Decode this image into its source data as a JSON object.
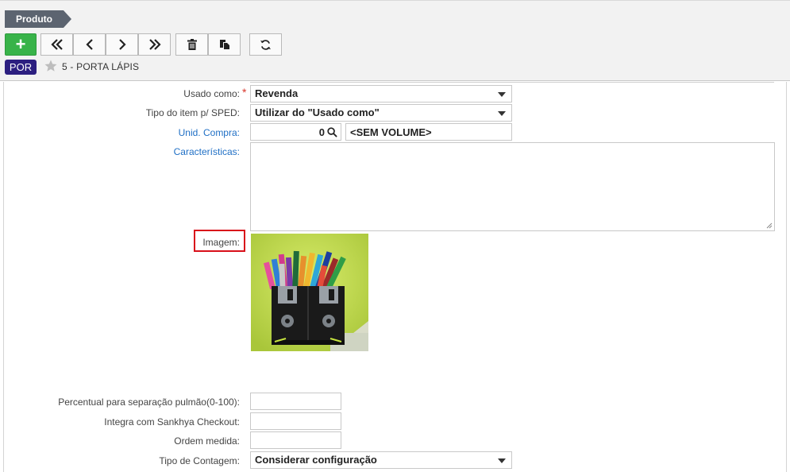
{
  "header": {
    "tab_label": "Produto",
    "add_label": "+",
    "language_badge": "POR",
    "record_title": "5 - PORTA LÁPIS"
  },
  "form": {
    "usado_como": {
      "label": "Usado como:",
      "required_mark": "*",
      "value": "Revenda"
    },
    "tipo_item_sped": {
      "label": "Tipo do item p/ SPED:",
      "value": "Utilizar do \"Usado como\""
    },
    "unid_compra": {
      "label": "Unid. Compra:",
      "code": "0",
      "description": "<SEM VOLUME>"
    },
    "caracteristicas": {
      "label": "Características:",
      "value": ""
    },
    "imagem": {
      "label": "Imagem:"
    },
    "percentual_pulmao": {
      "label": "Percentual para separação pulmão(0-100):",
      "value": ""
    },
    "sankhya_checkout": {
      "label": "Integra com Sankhya Checkout:",
      "value": ""
    },
    "ordem_medida": {
      "label": "Ordem medida:",
      "value": ""
    },
    "tipo_contagem": {
      "label": "Tipo de Contagem:",
      "value": "Considerar configuração"
    }
  },
  "colors": {
    "add_button": "#38b349",
    "badge": "#2c1f80",
    "link_label": "#1f6fc5",
    "highlight": "#d9101a"
  }
}
